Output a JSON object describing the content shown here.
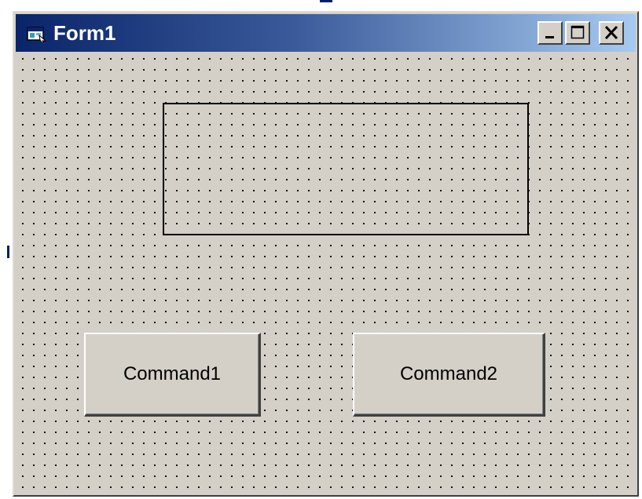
{
  "window": {
    "title": "Form1",
    "icon": "form-icon",
    "controls": {
      "minimize_icon": "minimize-icon",
      "maximize_icon": "maximize-icon",
      "close_icon": "close-icon"
    }
  },
  "form": {
    "frame": {
      "label": ""
    },
    "buttons": [
      {
        "label": "Command1"
      },
      {
        "label": "Command2"
      }
    ]
  },
  "colors": {
    "title_gradient_start": "#0a246a",
    "title_gradient_end": "#a6caf0",
    "face": "#d4d0c8",
    "grid_dot": "#000000"
  }
}
